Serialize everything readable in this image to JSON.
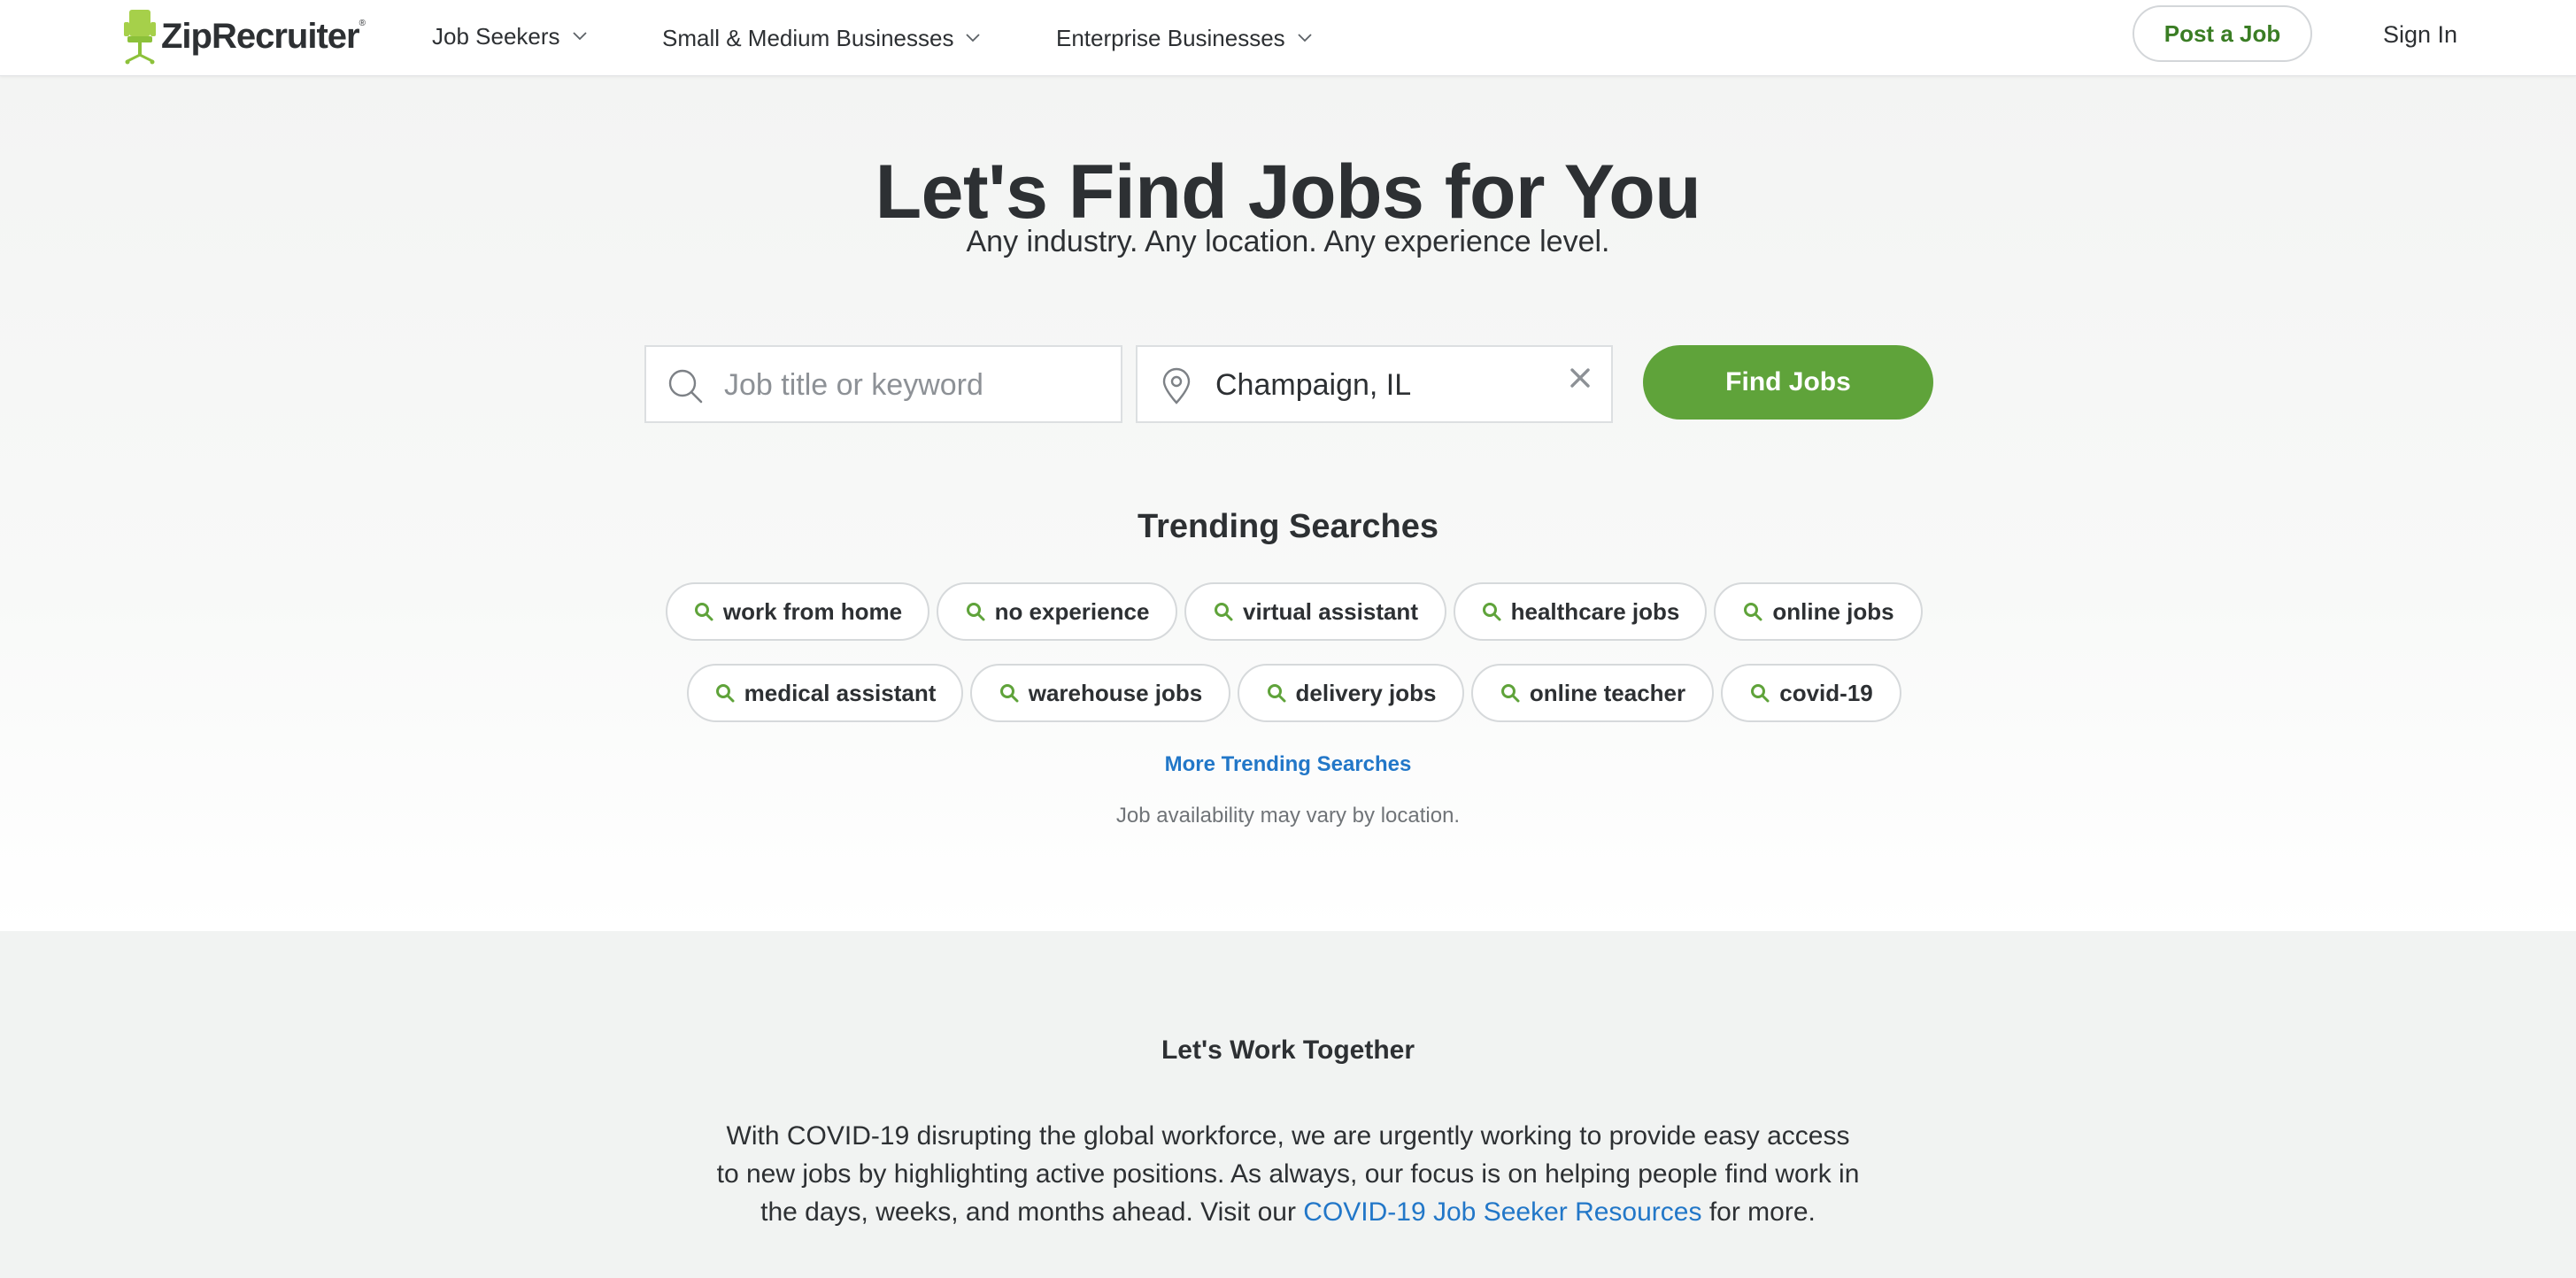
{
  "header": {
    "logo_text": "ZipRecruiter",
    "logo_mark": "®",
    "nav": [
      {
        "label": "Job Seekers",
        "icon": "chevron-down-icon"
      },
      {
        "label": "Small & Medium Businesses",
        "icon": "chevron-down-icon"
      },
      {
        "label": "Enterprise Businesses",
        "icon": "chevron-down-icon"
      }
    ],
    "post_job": "Post a Job",
    "sign_in": "Sign In"
  },
  "hero": {
    "title": "Let's Find Jobs for You",
    "subtitle": "Any industry. Any location. Any experience level.",
    "keyword": {
      "placeholder": "Job title or keyword",
      "value": "",
      "icon": "search-icon"
    },
    "location": {
      "value": "Champaign, IL",
      "icon": "location-pin-icon",
      "clear_icon": "close-icon"
    },
    "find_button": "Find Jobs"
  },
  "trending": {
    "title": "Trending Searches",
    "chip_icon": "search-icon",
    "rows": [
      [
        "work from home",
        "no experience",
        "virtual assistant",
        "healthcare jobs",
        "online jobs"
      ],
      [
        "medical assistant",
        "warehouse jobs",
        "delivery jobs",
        "online teacher",
        "covid-19"
      ]
    ],
    "more_link": "More Trending Searches",
    "note": "Job availability may vary by location."
  },
  "together": {
    "title": "Let's Work Together",
    "body_before": "With COVID-19 disrupting the global workforce, we are urgently working to provide easy access to new jobs by highlighting active positions. As always, our focus is on helping people find work in the days, weeks, and months ahead. Visit our ",
    "link": "COVID-19 Job Seeker Resources",
    "body_after": " for more."
  },
  "colors": {
    "brand_green": "#5fa33a",
    "logo_green": "#a6d04a",
    "link_blue": "#2277c8",
    "text_dark": "#2d3033"
  }
}
